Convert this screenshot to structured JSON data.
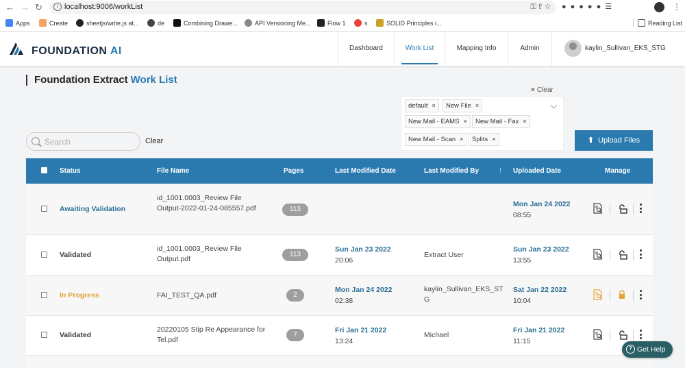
{
  "browser": {
    "url": "localhost:9006/workList",
    "bookmarks": [
      "Apps",
      "Create",
      "sheetjs/write.js at...",
      "de",
      "Combining Drawe...",
      "API Versioning Me...",
      "Flow 1",
      "s",
      "SOLID Principles i..."
    ],
    "reading_list": "Reading List"
  },
  "header": {
    "logo_main": "FOUNDATION",
    "logo_accent": "AI",
    "nav": [
      "Dashboard",
      "Work List",
      "Mapping Info",
      "Admin"
    ],
    "active_nav": "Work List",
    "user_name": "kaylin_Sullivan_EKS_STG"
  },
  "page": {
    "title_main": "Foundation Extract",
    "title_accent": "Work List"
  },
  "filters": {
    "clear_label": "Clear",
    "chips": [
      "default",
      "New File",
      "New Mail - EAMS",
      "New Mail - Fax",
      "New Mail - Scan",
      "Splits"
    ]
  },
  "search": {
    "placeholder": "Search",
    "clear_label": "Clear"
  },
  "upload_label": "Upload Files",
  "table": {
    "columns": [
      "Status",
      "File Name",
      "Pages",
      "Last Modified Date",
      "Last Modified By",
      "Uploaded Date",
      "Manage"
    ],
    "sort_indicator": "↑",
    "rows": [
      {
        "status": "Awaiting Validation",
        "file_name": "id_1001.0003_Review File Output-2022-01-24-085557.pdf",
        "pages": "113",
        "modified_date": "",
        "modified_time": "",
        "modified_by": "",
        "uploaded_date": "Mon Jan 24 2022",
        "uploaded_time": "08:55"
      },
      {
        "status": "Validated",
        "file_name": "id_1001.0003_Review File Output.pdf",
        "pages": "113",
        "modified_date": "Sun Jan 23 2022",
        "modified_time": "20:06",
        "modified_by": "Extract User",
        "uploaded_date": "Sun Jan 23 2022",
        "uploaded_time": "13:55"
      },
      {
        "status": "In Progress",
        "file_name": "FAI_TEST_QA.pdf",
        "pages": "2",
        "modified_date": "Mon Jan 24 2022",
        "modified_time": "02:38",
        "modified_by": "kaylin_Sullivan_EKS_STG",
        "uploaded_date": "Sat Jan 22 2022",
        "uploaded_time": "10:04"
      },
      {
        "status": "Validated",
        "file_name": "20220105 Stip Re Appearance for Tel.pdf",
        "pages": "7",
        "modified_date": "Fri Jan 21 2022",
        "modified_time": "13:24",
        "modified_by": "Michael",
        "uploaded_date": "Fri Jan 21 2022",
        "uploaded_time": "11:15"
      }
    ]
  },
  "help_label": "Get Help",
  "colors": {
    "primary": "#2a7ab0",
    "in_progress": "#e6a23c",
    "help": "#2a5f63"
  }
}
